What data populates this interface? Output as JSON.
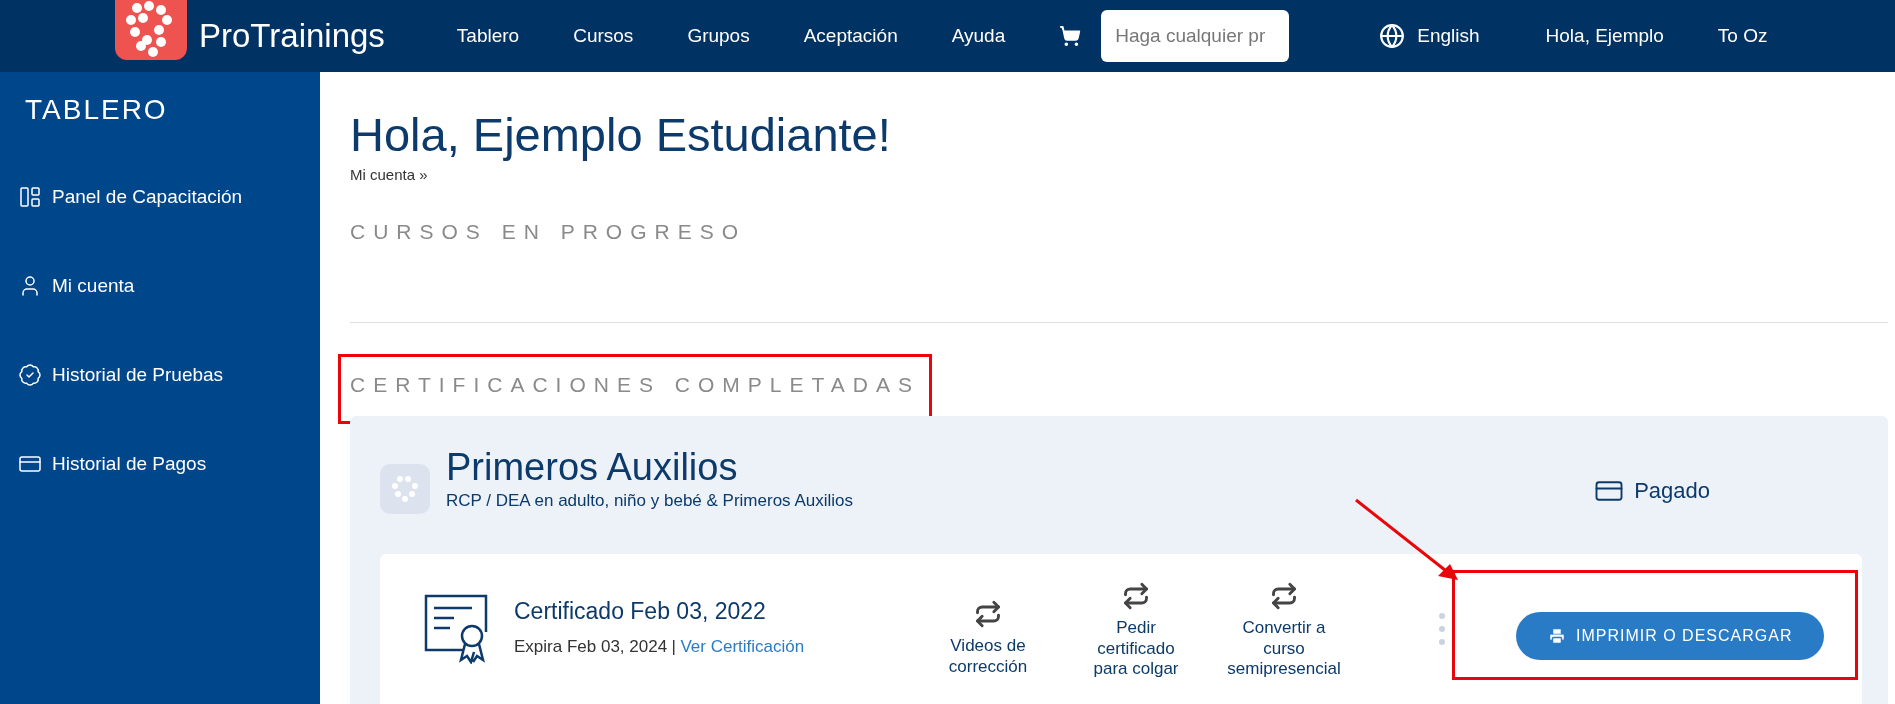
{
  "header": {
    "logo_text": "ProTrainings",
    "nav": [
      "Tablero",
      "Cursos",
      "Grupos",
      "Aceptación",
      "Ayuda"
    ],
    "search": {
      "placeholder": "Haga cualquier pr"
    },
    "language": "English",
    "greeting": "Hola, Ejemplo",
    "user": "To Oz"
  },
  "sidebar": {
    "title": "TABLERO",
    "items": [
      {
        "label": "Panel de Capacitación",
        "kind": "panel"
      },
      {
        "label": "Mi cuenta",
        "kind": "account"
      },
      {
        "label": "Historial de Pruebas",
        "kind": "tests"
      },
      {
        "label": "Historial de Pagos",
        "kind": "payments"
      }
    ]
  },
  "main": {
    "heading": "Hola, Ejemplo Estudiante!",
    "breadcrumb": "Mi cuenta »",
    "in_progress_title": "CURSOS EN PROGRESO",
    "completed_title": "CERTIFICACIONES COMPLETADAS",
    "course": {
      "title": "Primeros Auxilios",
      "subtitle": "RCP / DEA en adulto, niño y bebé & Primeros Auxilios",
      "payment_status": "Pagado",
      "certificate": {
        "title": "Certificado Feb 03, 2022",
        "expires": "Expira Feb 03, 2024",
        "separator": "|",
        "link": "Ver Certificación",
        "actions": [
          "Videos de\ncorrección",
          "Pedir\ncertificado\npara colgar",
          "Convertir a\ncurso\nsemipresencial"
        ],
        "button": "IMPRIMIR O DESCARGAR"
      }
    }
  }
}
